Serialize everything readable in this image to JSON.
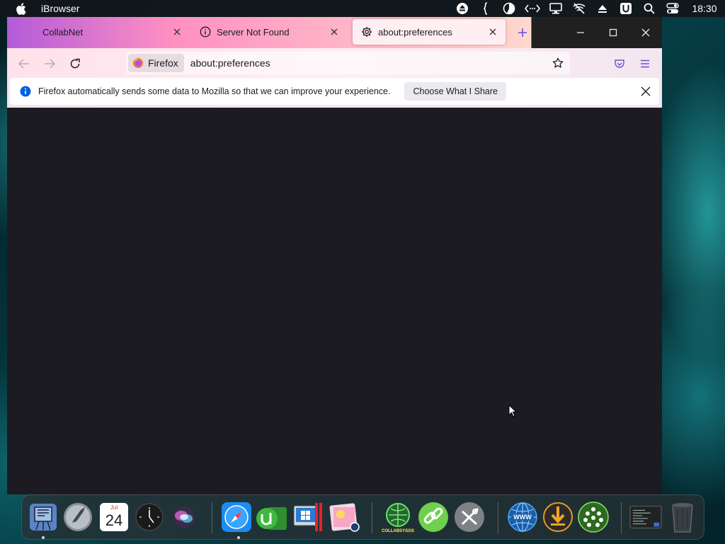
{
  "menubar": {
    "app_name": "iBrowser",
    "clock": "18:30",
    "status_icons": [
      "eject-icon",
      "script-icon",
      "pie-chart-icon",
      "code-arrows-icon",
      "display-icon",
      "wifi-off-icon",
      "upload-icon",
      "u-badge-icon",
      "search-icon",
      "control-center-icon"
    ]
  },
  "tabs": [
    {
      "label": "CollabNet",
      "icon": "none",
      "active": false
    },
    {
      "label": "Server Not Found",
      "icon": "info-icon",
      "active": false
    },
    {
      "label": "about:preferences",
      "icon": "gear-icon",
      "active": true
    }
  ],
  "navbar": {
    "identity_label": "Firefox",
    "url": "about:preferences"
  },
  "notification": {
    "message": "Firefox automatically sends some data to Mozilla so that we can improve your experience.",
    "button_label": "Choose What I Share"
  },
  "dock": {
    "calendar_month": "Jul",
    "calendar_day": "24",
    "items": [
      "finder-icon",
      "launchpad-icon",
      "calendar-icon",
      "clock-icon",
      "siri-icon",
      "safari-icon",
      "utorrent-icon",
      "files-icon",
      "parallels-icon",
      "photos-icon",
      "collabsysos-icon",
      "link-icon",
      "tools-icon",
      "www-icon",
      "download-icon",
      "network-icon",
      "terminal-icon",
      "trash-icon"
    ],
    "collabsysos_label": "COLLABSYSOS"
  },
  "colors": {
    "accent": "#0060df",
    "content_bg": "#1c1b22",
    "tab_active_bg": "#ffeef2"
  }
}
